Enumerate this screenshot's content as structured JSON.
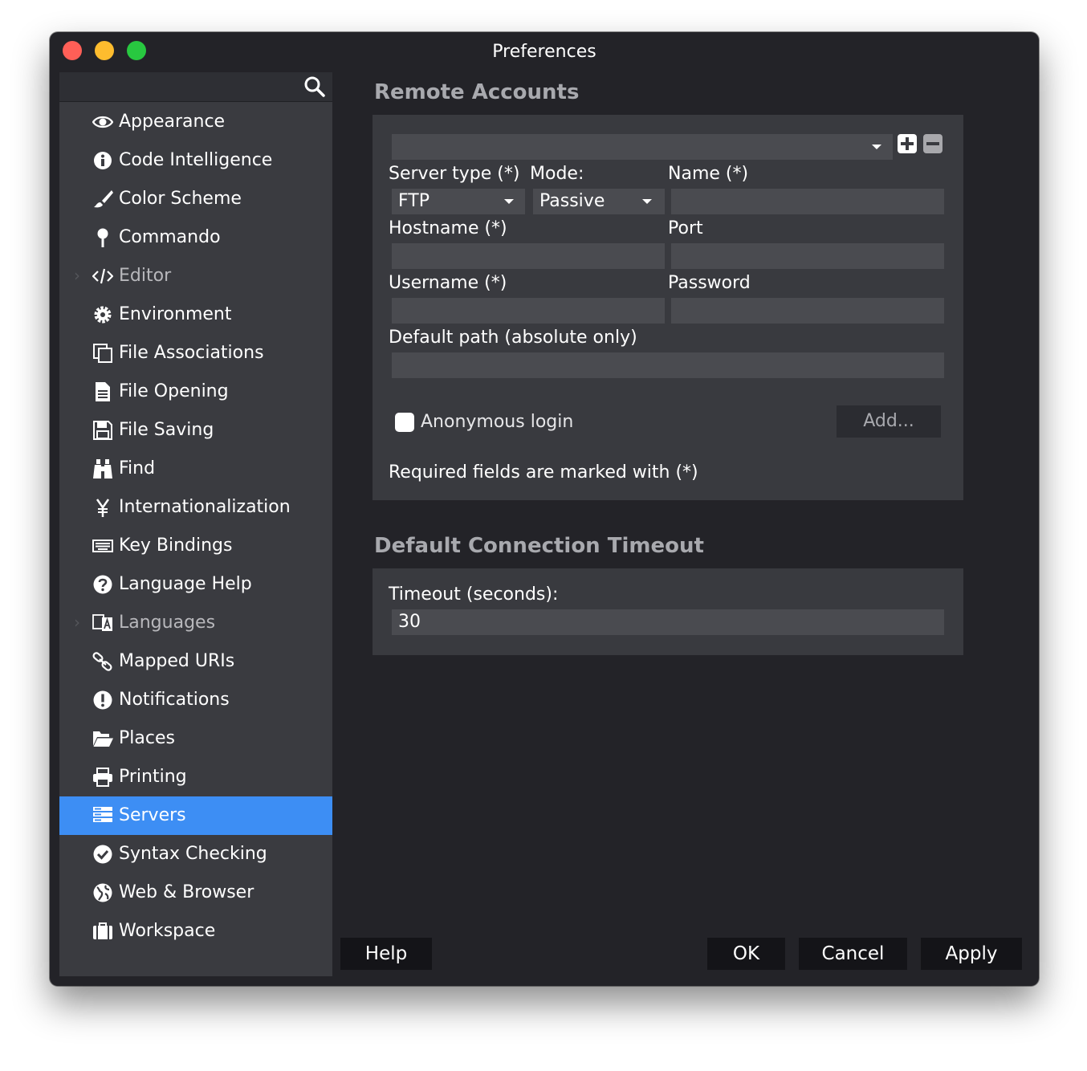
{
  "window": {
    "title": "Preferences"
  },
  "sidebar": {
    "search": {
      "placeholder": "",
      "icon": "search-icon"
    },
    "items": [
      {
        "label": "Appearance",
        "icon": "eye-icon"
      },
      {
        "label": "Code Intelligence",
        "icon": "info-icon"
      },
      {
        "label": "Color Scheme",
        "icon": "paintbrush-icon"
      },
      {
        "label": "Commando",
        "icon": "pin-icon"
      },
      {
        "label": "Editor",
        "icon": "code-icon",
        "expandable": true
      },
      {
        "label": "Environment",
        "icon": "gear-icon"
      },
      {
        "label": "File Associations",
        "icon": "copy-files-icon"
      },
      {
        "label": "File Opening",
        "icon": "file-text-icon"
      },
      {
        "label": "File Saving",
        "icon": "floppy-disk-icon"
      },
      {
        "label": "Find",
        "icon": "binoculars-icon"
      },
      {
        "label": "Internationalization",
        "icon": "yen-icon"
      },
      {
        "label": "Key Bindings",
        "icon": "keyboard-icon"
      },
      {
        "label": "Language Help",
        "icon": "question-circle-icon"
      },
      {
        "label": "Languages",
        "icon": "translate-icon",
        "expandable": true
      },
      {
        "label": "Mapped URIs",
        "icon": "link-icon"
      },
      {
        "label": "Notifications",
        "icon": "exclamation-circle-icon"
      },
      {
        "label": "Places",
        "icon": "folder-open-icon"
      },
      {
        "label": "Printing",
        "icon": "printer-icon"
      },
      {
        "label": "Servers",
        "icon": "server-list-icon",
        "selected": true
      },
      {
        "label": "Syntax Checking",
        "icon": "check-circle-icon"
      },
      {
        "label": "Web & Browser",
        "icon": "globe-icon"
      },
      {
        "label": "Workspace",
        "icon": "briefcase-icon"
      }
    ]
  },
  "remote_accounts": {
    "title": "Remote Accounts",
    "account_select": {
      "value": ""
    },
    "server_type": {
      "label": "Server type (*)",
      "value": "FTP"
    },
    "mode": {
      "label": "Mode:",
      "value": "Passive"
    },
    "name": {
      "label": "Name (*)",
      "value": ""
    },
    "hostname": {
      "label": "Hostname (*)",
      "value": ""
    },
    "port": {
      "label": "Port",
      "value": ""
    },
    "username": {
      "label": "Username (*)",
      "value": ""
    },
    "password": {
      "label": "Password",
      "value": ""
    },
    "default_path": {
      "label": "Default path (absolute only)",
      "value": ""
    },
    "anonymous_login": {
      "label": "Anonymous login",
      "checked": false
    },
    "add_button": "Add...",
    "required_note": "Required fields are marked with (*)"
  },
  "timeout": {
    "title": "Default Connection Timeout",
    "label": "Timeout (seconds):",
    "value": "30"
  },
  "buttons": {
    "help": "Help",
    "ok": "OK",
    "cancel": "Cancel",
    "apply": "Apply"
  },
  "colors": {
    "selection": "#3d8ef4",
    "window_bg": "#232328",
    "sidebar_bg": "#3a3b40",
    "panel_bg": "#393a3f"
  }
}
